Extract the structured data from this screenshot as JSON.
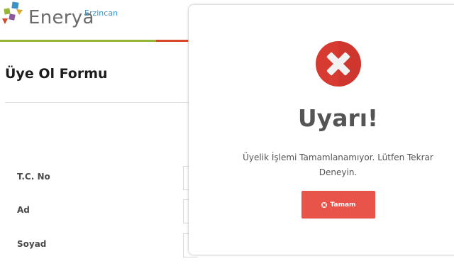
{
  "header": {
    "brand_name": "Enerya",
    "brand_region": "Erzincan",
    "accent_colors": [
      "#97b534",
      "#d6482a",
      "#c7c7c7"
    ]
  },
  "form": {
    "title": "Üye Ol Formu",
    "fields": [
      {
        "label": "T.C. No",
        "value": ""
      },
      {
        "label": "Ad",
        "value": ""
      },
      {
        "label": "Soyad",
        "value": ""
      }
    ]
  },
  "modal": {
    "icon": "error-x-icon",
    "title": "Uyarı!",
    "message": "Üyelik İşlemi Tamamlanamıyor. Lütfen Tekrar Deneyin.",
    "button_label": "Tamam",
    "button_icon": "close-circle-icon",
    "accent_color": "#e8534a"
  }
}
